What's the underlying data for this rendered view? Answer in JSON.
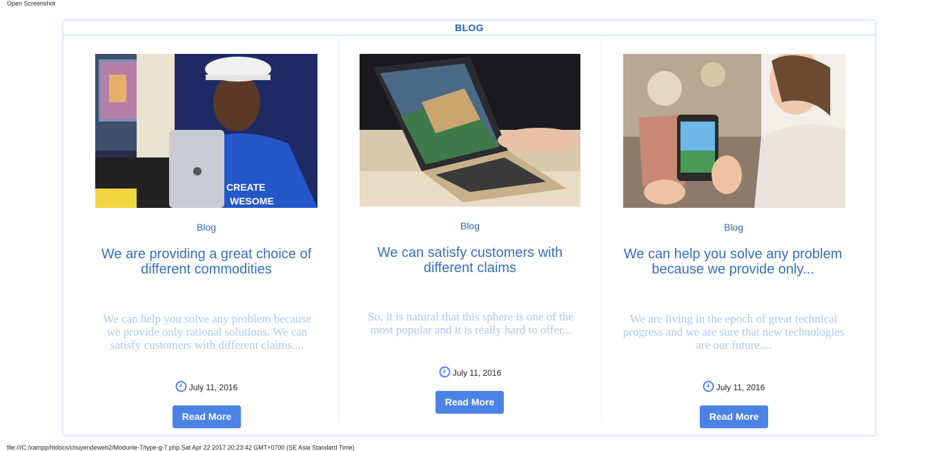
{
  "screenshot_caption": "Open Screenshot",
  "footer_url": "file:///C:/xampp/htdocs/chuyendeweb2/Modunle-7/type-g-7.php Sat Apr 22 2017 20:23:42 GMT+0700 (SE Asia Standard Time)",
  "section": {
    "title": "BLOG"
  },
  "accent_color": "#4b82e6",
  "posts": [
    {
      "image": "man-holding-ipad-photo",
      "category": "Blog",
      "title": "We are providing a great choice of different commodities",
      "excerpt": "We can help you solve any problem because we provide only rational solutions. We can satisfy customers with different claims....",
      "date": "July 11, 2016",
      "button": "Read More"
    },
    {
      "image": "laptop-on-desk-photo",
      "category": "Blog",
      "title": "We can satisfy customers with different claims",
      "excerpt": "So, it is natural that this sphere is one of the most popular and it is really hard to offer...",
      "date": "July 11, 2016",
      "button": "Read More"
    },
    {
      "image": "woman-holding-smartphone-photo",
      "category": "Blog",
      "title": "We can help you solve any problem because we provide only...",
      "excerpt": "We are living in the epoch of great technical progress and we are sure that new technologies are our future....",
      "date": "July 11, 2016",
      "button": "Read More"
    }
  ]
}
